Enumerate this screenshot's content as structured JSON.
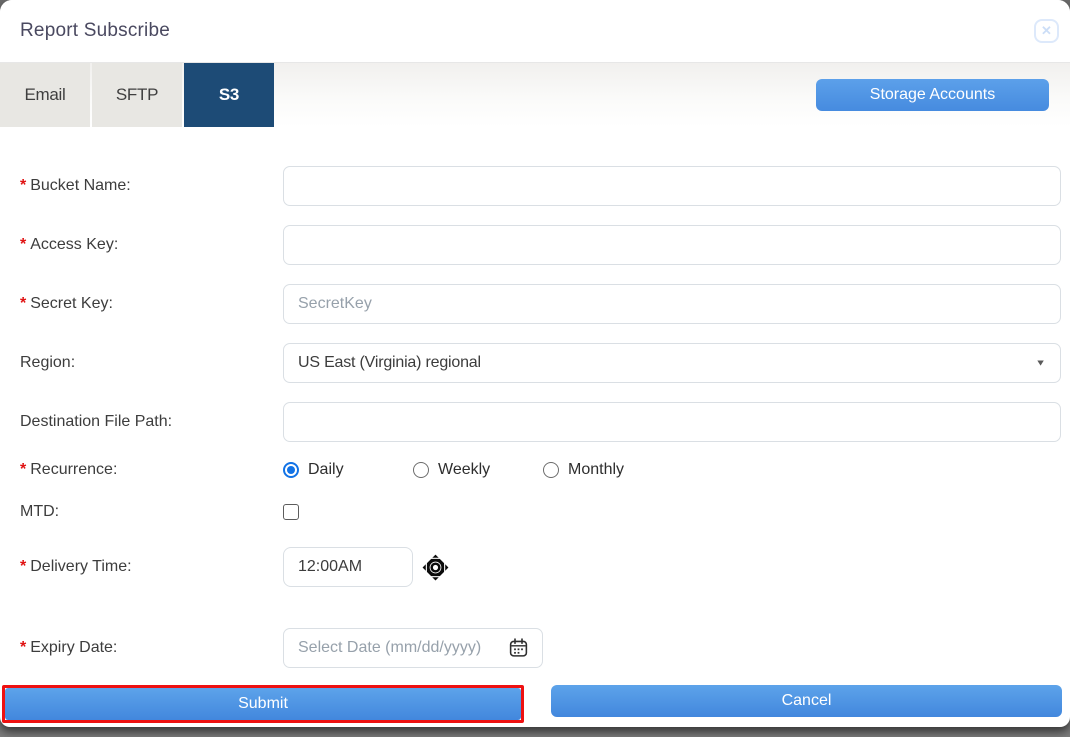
{
  "header": {
    "title": "Report Subscribe"
  },
  "icons": {
    "close": "✕",
    "dropdown": "▼",
    "time_picker": "diamond-arrows-with-ring",
    "calendar": "calendar-grid"
  },
  "tabs": {
    "items": [
      {
        "label": "Email",
        "active": false
      },
      {
        "label": "SFTP",
        "active": false
      },
      {
        "label": "S3",
        "active": true
      }
    ],
    "storage_accounts_label": "Storage Accounts"
  },
  "form": {
    "required_marker": "*",
    "bucket_name": {
      "label": "Bucket Name:",
      "required": true,
      "value": "",
      "placeholder": ""
    },
    "access_key": {
      "label": "Access Key:",
      "required": true,
      "value": "",
      "placeholder": ""
    },
    "secret_key": {
      "label": "Secret Key:",
      "required": true,
      "value": "",
      "placeholder": "SecretKey"
    },
    "region": {
      "label": "Region:",
      "required": false,
      "selected": "US East (Virginia) regional"
    },
    "destination_file_path": {
      "label": "Destination File Path:",
      "required": false,
      "value": "",
      "placeholder": ""
    },
    "recurrence": {
      "label": "Recurrence:",
      "required": true,
      "options": [
        "Daily",
        "Weekly",
        "Monthly"
      ],
      "selected": "Daily"
    },
    "mtd": {
      "label": "MTD:",
      "checked": false
    },
    "delivery_time": {
      "label": "Delivery Time:",
      "required": true,
      "value": "12:00AM"
    },
    "expiry_date": {
      "label": "Expiry Date:",
      "required": true,
      "placeholder": "Select Date (mm/dd/yyyy)"
    }
  },
  "footer": {
    "submit_label": "Submit",
    "cancel_label": "Cancel"
  },
  "colors": {
    "active_tab_navy": "#1d4b76",
    "button_blue": "#4a90e2",
    "highlight_red": "#ee1111",
    "required_red": "#e01212"
  }
}
